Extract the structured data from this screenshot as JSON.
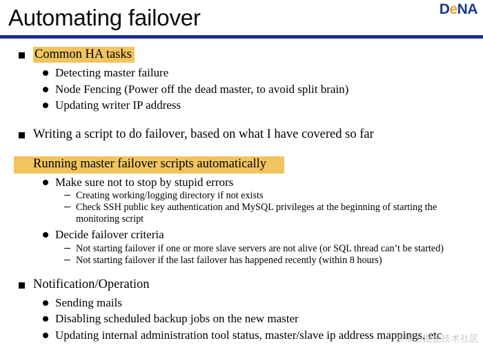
{
  "slide": {
    "title": "Automating failover",
    "logo": {
      "part1": "D",
      "part2": "e",
      "part3": "NA",
      "navy_color": "#1b3a8c",
      "orange_color": "#f0a02a"
    },
    "rule_color": "#1e2f8f",
    "highlight_color": "#f2c45e",
    "watermark": "©稀土掘金技术社区"
  },
  "outline": {
    "section1": {
      "heading": "Common HA tasks",
      "highlighted": true,
      "items": [
        "Detecting master failure",
        "Node Fencing (Power off the dead master, to avoid split brain)",
        "Updating writer IP address"
      ]
    },
    "section2": {
      "heading": "Writing a script to do failover, based on what I have covered so far",
      "highlighted": false
    },
    "section3": {
      "heading": "Running master failover scripts automatically",
      "highlighted": true,
      "item1": {
        "label": "Make sure not to stop by stupid errors",
        "subitems": [
          "Creating working/logging directory if not exists",
          "Check SSH public key authentication and MySQL privileges at the beginning of starting the monitoring script"
        ]
      },
      "item2": {
        "label": "Decide failover criteria",
        "subitems": [
          "Not starting failover if one or more slave servers are not alive (or SQL thread can’t be started)",
          "Not starting failover if the last failover has happened recently (within 8 hours)"
        ]
      }
    },
    "section4": {
      "heading": "Notification/Operation",
      "highlighted": false,
      "items": [
        "Sending mails",
        "Disabling scheduled backup jobs on the new master",
        "Updating internal administration tool status, master/slave ip address mappings, etc"
      ]
    }
  }
}
